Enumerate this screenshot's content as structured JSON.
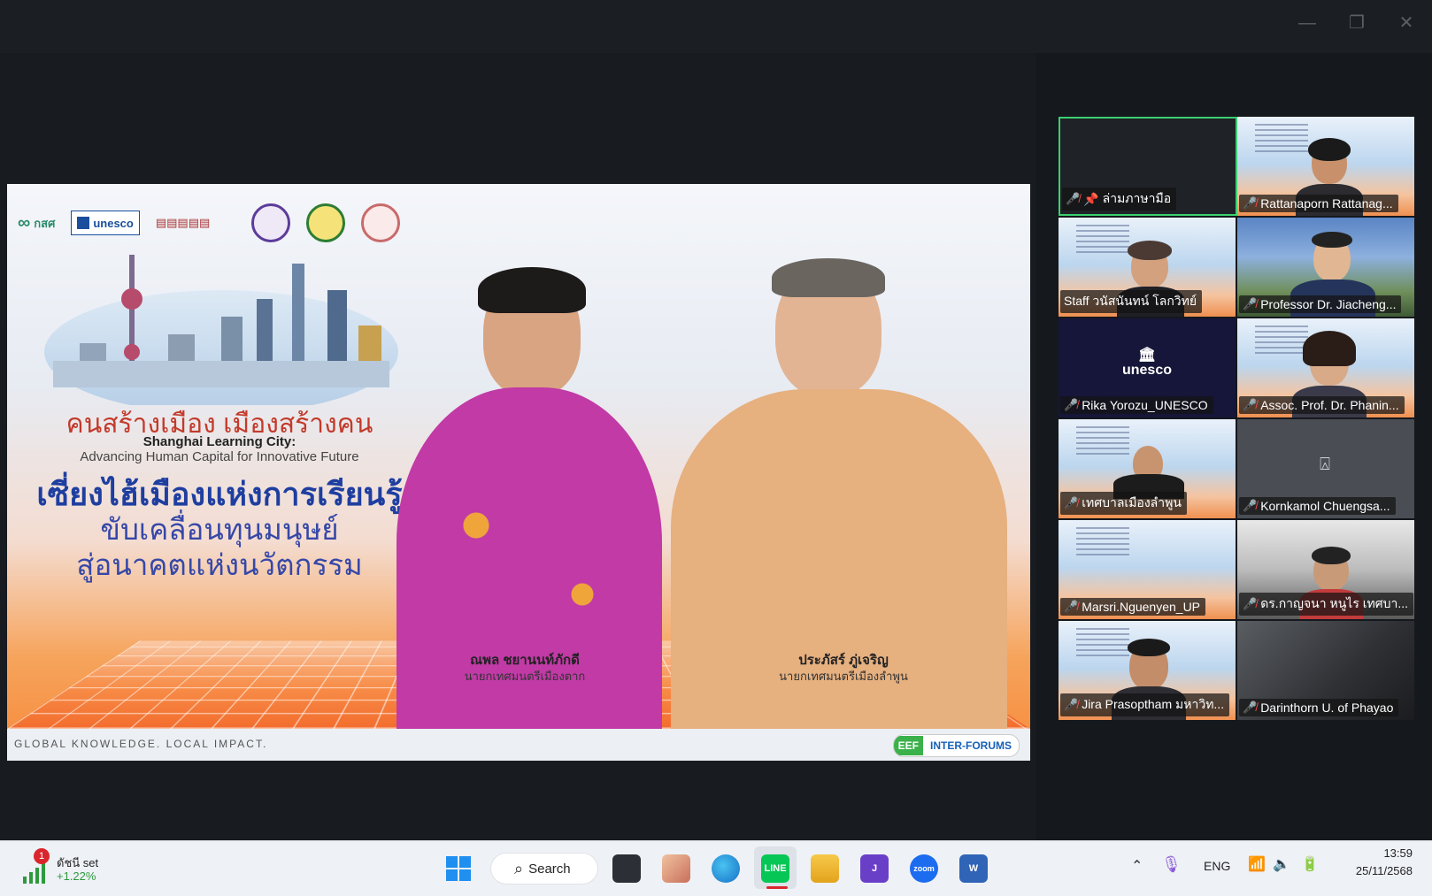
{
  "window": {
    "minimize": "—",
    "restore": "❐",
    "close": "✕"
  },
  "slide": {
    "logos": [
      "กสศ",
      "unesco"
    ],
    "title_th1": "คนสร้างเมือง เมืองสร้างคน",
    "title_en1": "Shanghai Learning City:",
    "title_en2": "Advancing Human Capital for Innovative Future",
    "title_th2": "เซี่ยงไฮ้เมืองแห่งการเรียนรู้",
    "title_th3": "ขับเคลื่อนทุนมนุษย์",
    "title_th4": "สู่อนาคตแห่งนวัตกรรม",
    "speakers": [
      {
        "name": "ณพล ชยานนท์ภักดี",
        "role": "นายกเทศมนตรีเมืองตาก",
        "shirt": "#c13aa6"
      },
      {
        "name": "ประภัสร์ ภู่เจริญ",
        "role": "นายกเทศมนตรีเมืองลำพูน",
        "shirt": "#e6b07f"
      }
    ],
    "footer_text": "GLOBAL KNOWLEDGE. LOCAL IMPACT.",
    "badge_left": "EEF",
    "badge_right": "INTER-FORUMS"
  },
  "participants": [
    {
      "name": "ล่ามภาษามือ",
      "kind": "blank",
      "pinned": true,
      "active": true
    },
    {
      "name": "Rattanaporn Rattanag...",
      "kind": "slide"
    },
    {
      "name": "Staff วนัสนันทน์ โลกวิทย์",
      "kind": "slide"
    },
    {
      "name": "Professor Dr. Jiacheng...",
      "kind": "outdoor"
    },
    {
      "name": "Rika Yorozu_UNESCO",
      "kind": "unesco",
      "tile_text": "unesco"
    },
    {
      "name": "Assoc. Prof. Dr. Phanin...",
      "kind": "slide"
    },
    {
      "name": "เทศบาลเมืองลำพูน",
      "kind": "slide"
    },
    {
      "name": "Kornkamol Chuengsa...",
      "kind": "avatar"
    },
    {
      "name": "Marsri.Nguenyen_UP",
      "kind": "slide"
    },
    {
      "name": "ดร.กาญจนา หนูไร เทศบา...",
      "kind": "office"
    },
    {
      "name": "Jira Prasoptham มหาวิท...",
      "kind": "slide"
    },
    {
      "name": "Darinthorn U. of Phayao",
      "kind": "dim"
    }
  ],
  "taskbar": {
    "stock_name": "ดัชนี set",
    "stock_change": "+1.22%",
    "stock_badge": "1",
    "search_label": "Search",
    "apps": [
      "line-app",
      "zoom-app",
      "word-app"
    ],
    "line_label": "LINE",
    "zoom_label": "zoom",
    "word_label": "W",
    "lang": "ENG",
    "time": "13:59",
    "date": "25/11/2568"
  }
}
